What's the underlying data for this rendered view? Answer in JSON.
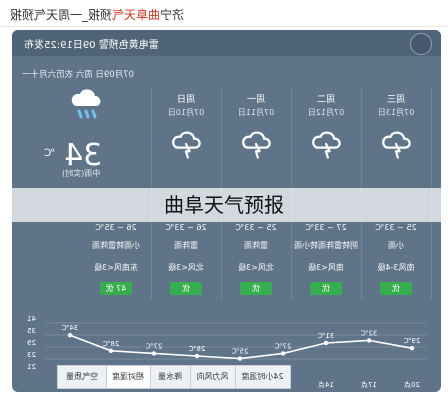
{
  "breadcrumb": {
    "prefix": "济宁",
    "highlight": "曲阜天气",
    "rest": "预报_一周天气预报"
  },
  "header": {
    "published": "雷电黄色预警 09日19:25发布"
  },
  "today": {
    "date_line": "07月09日 周六 农历六月十一",
    "temp": "34",
    "unit": "℃",
    "subline": "中雨(实时)"
  },
  "days": [
    {
      "day": "周三",
      "date": "07月13日",
      "range": "25 ~ 33℃",
      "cond": "小雨",
      "wind": "南风3-4级",
      "aqi": "优"
    },
    {
      "day": "周二",
      "date": "07月12日",
      "range": "27 ~ 33℃",
      "cond": "阴转雷阵雨转小雨",
      "wind": "南风<3级",
      "aqi": "优"
    },
    {
      "day": "周一",
      "date": "07月11日",
      "range": "25 ~ 33℃",
      "cond": "雷阵雨",
      "wind": "北风<3级",
      "aqi": "优"
    },
    {
      "day": "周日",
      "date": "07月10日",
      "range": "26 ~ 33℃",
      "cond": "雷阵雨",
      "wind": "北风<3级",
      "aqi": "优"
    },
    {
      "day": "周六",
      "date": "07月09日",
      "range": "26 ~ 35℃",
      "cond": "小雨转雷阵雨",
      "wind": "东南风<3级",
      "aqi": "47 优"
    }
  ],
  "hourly": {
    "times": [
      "20点",
      "17点",
      "14点",
      "11点",
      "08点",
      "05点",
      "02点",
      "23点",
      "现在"
    ],
    "temps": [
      "29℃",
      "32℃",
      "31℃",
      "27℃",
      "25℃",
      "26℃",
      "27℃",
      "28℃",
      "34℃"
    ],
    "axis": [
      "41",
      "35",
      "29",
      "23",
      "21"
    ]
  },
  "tabs": [
    "24小时温度",
    "风力风向",
    "降水量",
    "相对湿度",
    "空气质量"
  ],
  "overlay_title": "曲阜天气预报"
}
